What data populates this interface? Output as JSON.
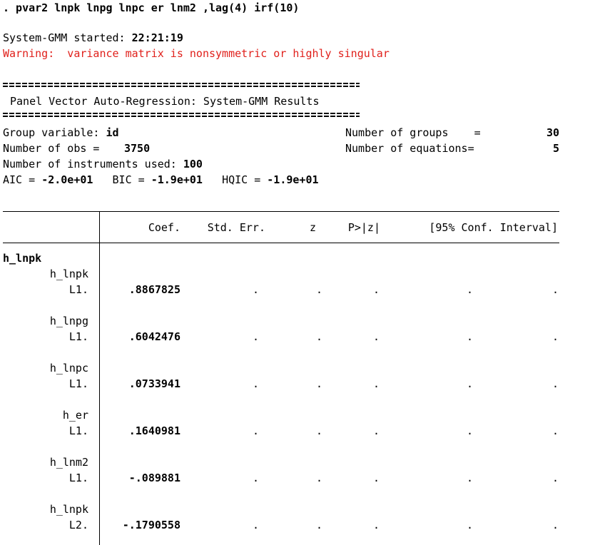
{
  "command": ". pvar2 lnpk lnpg lnpc er lnm2 ,lag(4) irf(10)",
  "started_label": "System-GMM started: ",
  "started_time": "22:21:19",
  "warning": "Warning:  variance matrix is nonsymmetric or highly singular",
  "title": "Panel Vector Auto-Regression: System-GMM Results",
  "stats": {
    "group_var_label": "Group variable: ",
    "group_var": "id",
    "num_groups_label": "Number of groups    =",
    "num_groups": "30",
    "num_obs_label": "Number of obs =",
    "num_obs": "3750",
    "num_eq_label": "Number of equations=",
    "num_eq": "5",
    "instruments_label": "Number of instruments used: ",
    "instruments": "100",
    "aic_label": "AIC = ",
    "aic": "-2.0e+01",
    "bic_label": "BIC = ",
    "bic": "-1.9e+01",
    "hqic_label": "HQIC = ",
    "hqic": "-1.9e+01"
  },
  "table": {
    "headers": [
      "Coef.",
      "Std. Err.",
      "z",
      "P>|z|",
      "[95% Conf. Interval]"
    ],
    "equation": "h_lnpk",
    "rows": [
      {
        "var": "h_lnpk",
        "lag": "L1.",
        "coef": ".8867825",
        "se": ".",
        "z": ".",
        "p": ".",
        "ci_lo": ".",
        "ci_hi": "."
      },
      {
        "var": "h_lnpg",
        "lag": "L1.",
        "coef": ".6042476",
        "se": ".",
        "z": ".",
        "p": ".",
        "ci_lo": ".",
        "ci_hi": "."
      },
      {
        "var": "h_lnpc",
        "lag": "L1.",
        "coef": ".0733941",
        "se": ".",
        "z": ".",
        "p": ".",
        "ci_lo": ".",
        "ci_hi": "."
      },
      {
        "var": "h_er",
        "lag": "L1.",
        "coef": ".1640981",
        "se": ".",
        "z": ".",
        "p": ".",
        "ci_lo": ".",
        "ci_hi": "."
      },
      {
        "var": "h_lnm2",
        "lag": "L1.",
        "coef": "-.089881",
        "se": ".",
        "z": ".",
        "p": ".",
        "ci_lo": ".",
        "ci_hi": "."
      },
      {
        "var": "h_lnpk",
        "lag": "L2.",
        "coef": "-.1790558",
        "se": ".",
        "z": ".",
        "p": ".",
        "ci_lo": ".",
        "ci_hi": "."
      }
    ]
  }
}
